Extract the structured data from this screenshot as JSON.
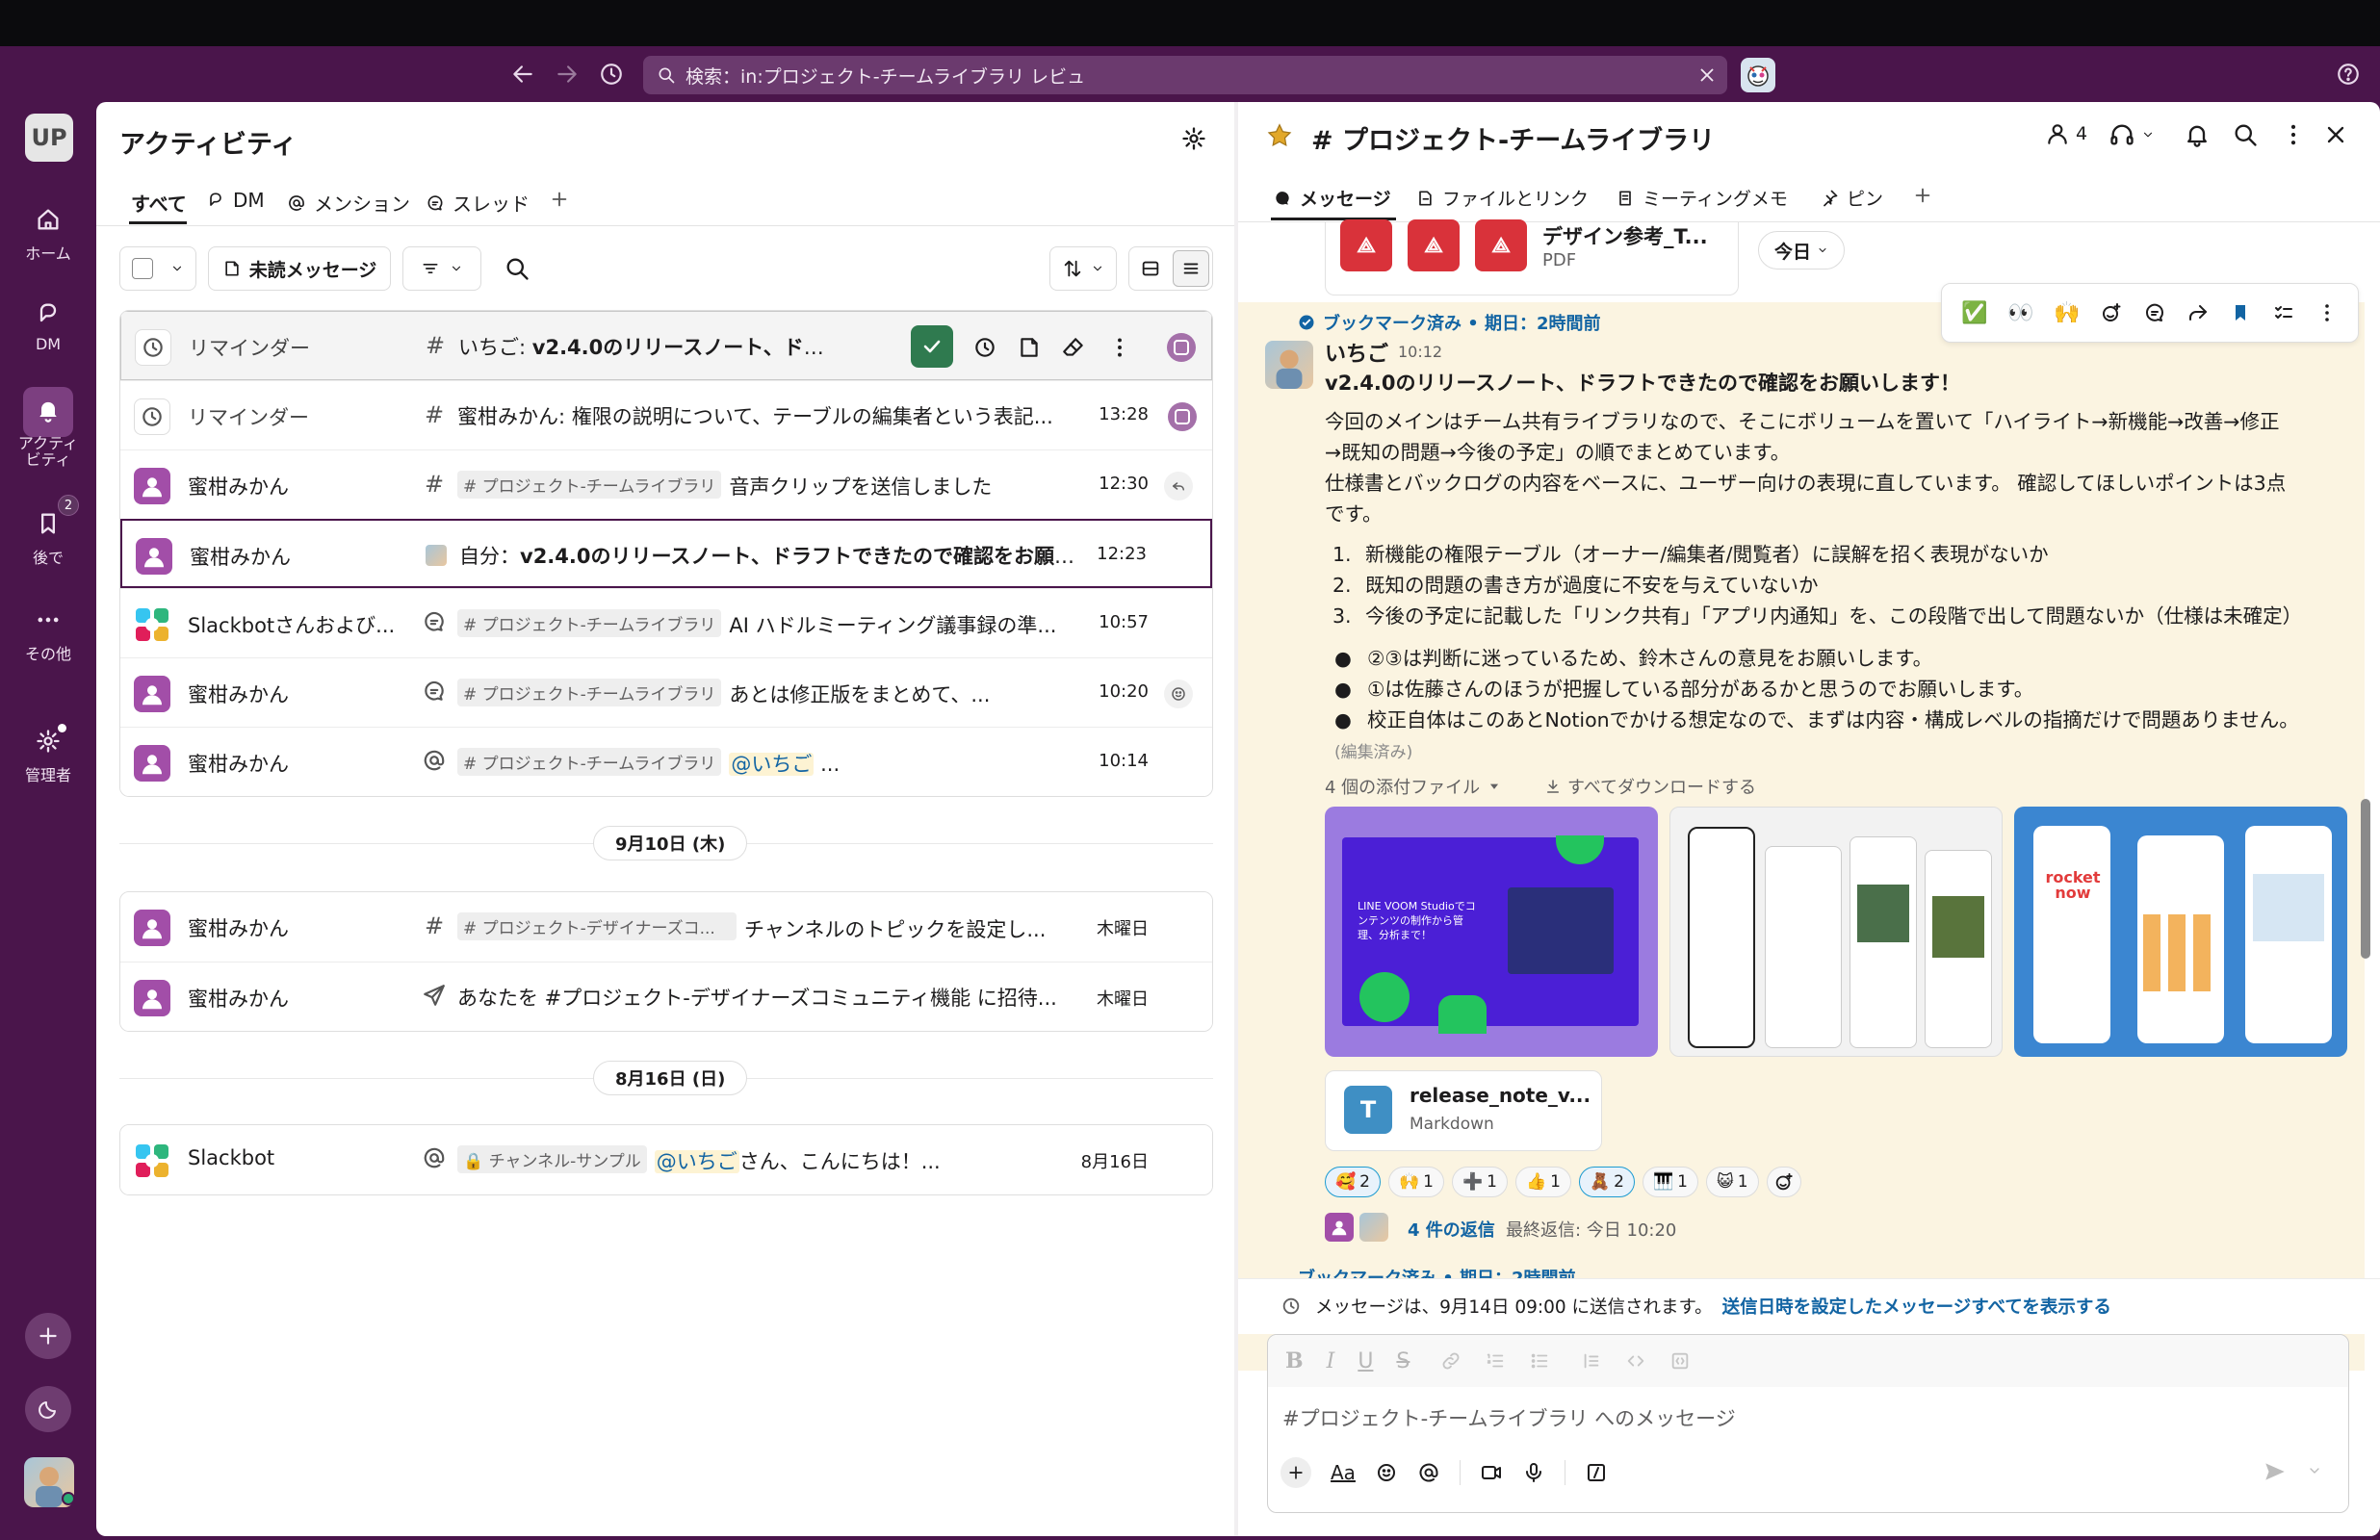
{
  "search": {
    "placeholder": "検索：in:プロジェクト-チームライブラリ レビュ"
  },
  "rail": {
    "workspace": "UP",
    "items": [
      {
        "label": "ホーム"
      },
      {
        "label": "DM"
      },
      {
        "label": "アクティ\nビティ"
      },
      {
        "label": "後で",
        "badge": "2"
      },
      {
        "label": "その他"
      },
      {
        "label": "管理者"
      }
    ]
  },
  "activity": {
    "title": "アクティビティ",
    "tabs": [
      "すべて",
      "DM",
      "メンション",
      "スレッド"
    ],
    "filters": {
      "unread": "未読メッセージ"
    },
    "today_rows": [
      {
        "name": "リマインダー",
        "sender": "いちご:",
        "text": "v2.4.0のリリースノート、ドラフト...",
        "time": ""
      },
      {
        "name": "リマインダー",
        "sender": "",
        "text": "蜜柑みかん: 権限の説明について、テーブルの編集者という表記...",
        "time": "13:28"
      },
      {
        "name": "蜜柑みかん",
        "tag": "# プロジェクト-チームライブラリ",
        "text": "音声クリップを送信しました",
        "time": "12:30"
      },
      {
        "name": "蜜柑みかん",
        "sender": "自分：",
        "text": "v2.4.0のリリースノート、ドラフトできたので確認をお願...",
        "time": "12:23"
      },
      {
        "name": "Slackbotさんおよび...",
        "tag": "# プロジェクト-チームライブラリ",
        "text": "AI ハドルミーティング議事録の準...",
        "time": "10:57"
      },
      {
        "name": "蜜柑みかん",
        "tag": "# プロジェクト-チームライブラリ",
        "text": "あとは修正版をまとめて、...",
        "time": "10:20"
      },
      {
        "name": "蜜柑みかん",
        "tag": "# プロジェクト-チームライブラリ",
        "mention": "@いちご",
        "text": "...",
        "time": "10:14"
      }
    ],
    "date1": "9月10日 (木)",
    "sep1_rows": [
      {
        "name": "蜜柑みかん",
        "tag": "# プロジェクト-デザイナーズコ...",
        "text": "チャンネルのトピックを設定し...",
        "time": "木曜日"
      },
      {
        "name": "蜜柑みかん",
        "text": "あなたを #プロジェクト-デザイナーズコミュニティ機能 に招待...",
        "time": "木曜日"
      }
    ],
    "date2": "8月16日 (日)",
    "sep2_rows": [
      {
        "name": "Slackbot",
        "tag": "チャンネル-サンプル",
        "mention": "@いちご",
        "text": "さん、こんにちは！...",
        "time": "8月16日"
      }
    ]
  },
  "channel": {
    "title": "# プロジェクト-チームライブラリ",
    "members": "4",
    "tabs": [
      "メッセージ",
      "ファイルとリンク",
      "ミーティングメモ",
      "ピン"
    ],
    "prev_file": {
      "name": "デザイン参考_T...",
      "type": "PDF"
    },
    "today_pill": "今日",
    "bookmark": "ブックマーク済み • 期日：2時間前",
    "author": "いちご",
    "time": "10:12",
    "headline": "v2.4.0のリリースノート、ドラフトできたので確認をお願いします！",
    "para1a": "今回のメインはチーム共有ライブラリなので、そこにボリュームを置いて「ハイライト→新機能→改善→修正",
    "para1b": "→既知の問題→今後の予定」の順でまとめています。",
    "para2a": "仕様書とバックログの内容をベースに、ユーザー向けの表現に直しています。 確認してほしいポイントは3点",
    "para2b": "です。",
    "numbered": [
      "新機能の権限テーブル（オーナー/編集者/閲覧者）に誤解を招く表現がないか",
      "既知の問題の書き方が過度に不安を与えていないか",
      "今後の予定に記載した「リンク共有」「アプリ内通知」を、この段階で出して問題ないか（仕様は未確定）"
    ],
    "bullets": [
      "②③は判断に迷っているため、鈴木さんの意見をお願いします。",
      "①は佐藤さんのほうが把握している部分があるかと思うのでお願いします。",
      "校正自体はこのあとNotionでかける想定なので、まずは内容・構成レベルの指摘だけで問題ありません。"
    ],
    "edited": "(編集済み)",
    "attachments": "4 個の添付ファイル",
    "download_all": "すべてダウンロードする",
    "thumb1_text": "LINE VOOM Studioでコンテンツの制作から管理、分析まで！",
    "thumb3_text": "rocket now",
    "file": {
      "name": "release_note_v...",
      "type": "Markdown",
      "icon": "T"
    },
    "reactions": [
      {
        "emoji": "🥰",
        "count": "2"
      },
      {
        "emoji": "🙌",
        "count": "1"
      },
      {
        "emoji": "➕",
        "count": "1"
      },
      {
        "emoji": "👍",
        "count": "1"
      },
      {
        "emoji": "🧸",
        "count": "2"
      },
      {
        "emoji": "🎹",
        "count": "1"
      },
      {
        "emoji": "😺",
        "count": "1"
      }
    ],
    "replies": "4 件の返信",
    "last_reply": "最終返信: 今日 10:20",
    "scheduled_text": "メッセージは、9月14日 09:00 に送信されます。",
    "scheduled_link": "送信日時を設定したメッセージすべてを表示する",
    "composer_placeholder": "#プロジェクト-チームライブラリ へのメッセージ"
  },
  "colors": {
    "brand": "#4a154b",
    "accent": "#2f7a4f",
    "link": "#1264a3",
    "highlight": "#fbf4e1"
  }
}
